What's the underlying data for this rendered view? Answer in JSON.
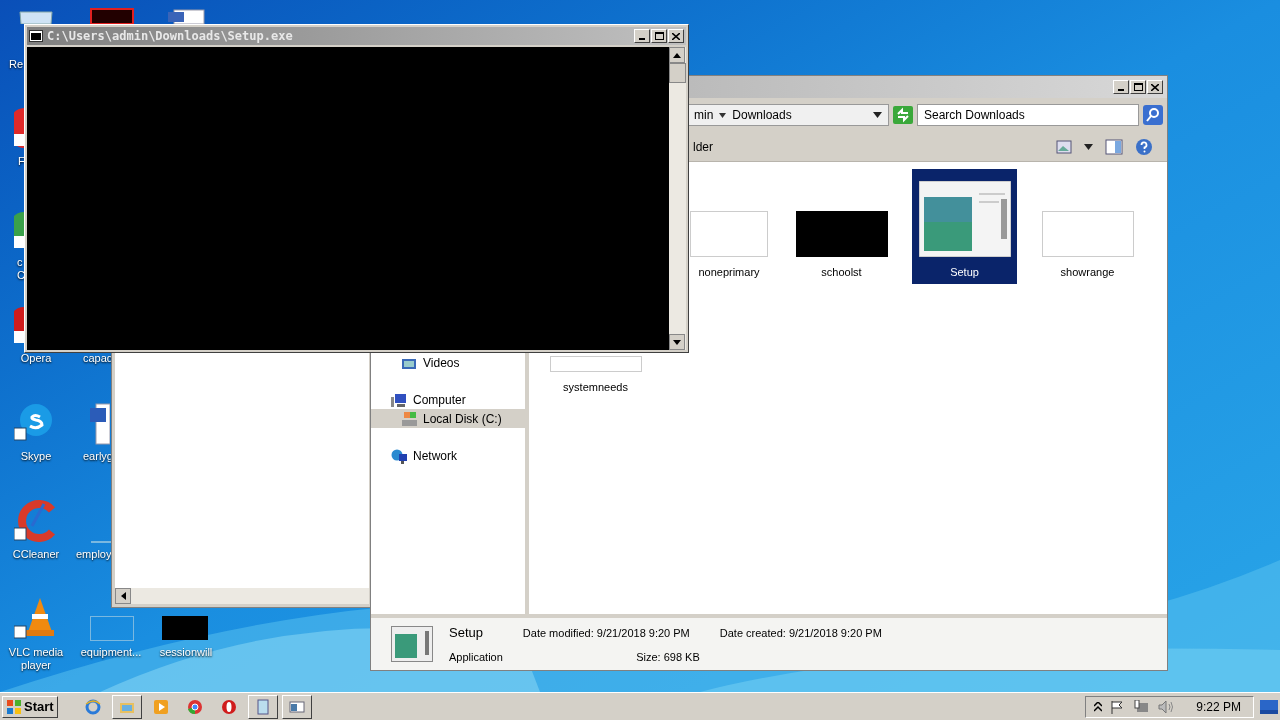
{
  "desktop_icons": [
    {
      "label": "Re",
      "kind": "bin"
    },
    {
      "label": "F",
      "kind": "redball"
    },
    {
      "label": "c\nC",
      "kind": "chrome"
    },
    {
      "label": "Opera",
      "kind": "opera"
    },
    {
      "label": "capad",
      "kind": "hidden"
    },
    {
      "label": "Skype",
      "kind": "skype"
    },
    {
      "label": "earlyg",
      "kind": "word"
    },
    {
      "label": "CCleaner",
      "kind": "ccleaner"
    },
    {
      "label": "employ",
      "kind": "line"
    },
    {
      "label": "VLC media\nplayer",
      "kind": "vlc"
    },
    {
      "label": "equipment...",
      "kind": "outline"
    },
    {
      "label": "sessionwill",
      "kind": "black"
    }
  ],
  "console": {
    "title": "C:\\Users\\admin\\Downloads\\Setup.exe"
  },
  "explorer": {
    "breadcrumb": [
      "min",
      "Downloads"
    ],
    "search": {
      "placeholder": "Search Downloads"
    },
    "toolbar_text": "lder",
    "nav": [
      {
        "label": "Videos",
        "kind": "videos",
        "selected": false
      },
      {
        "label": "Computer",
        "kind": "computer",
        "selected": false
      },
      {
        "label": "Local Disk (C:)",
        "kind": "disk",
        "selected": true
      },
      {
        "label": "Network",
        "kind": "network",
        "selected": false
      }
    ],
    "files": [
      {
        "name": "noneprimary",
        "kind": "blank",
        "selected": false
      },
      {
        "name": "schoolst",
        "kind": "dark",
        "selected": false
      },
      {
        "name": "Setup",
        "kind": "app",
        "selected": true
      },
      {
        "name": "showrange",
        "kind": "blank",
        "selected": false
      },
      {
        "name": "systemneeds",
        "kind": "blank",
        "selected": false
      }
    ],
    "details": {
      "name": "Setup",
      "type": "Application",
      "fields": [
        {
          "label": "Date modified:",
          "value": "9/21/2018 9:20 PM"
        },
        {
          "label": "Date created:",
          "value": "9/21/2018 9:20 PM"
        },
        {
          "label": "Size:",
          "value": "698 KB"
        }
      ]
    }
  },
  "taskbar": {
    "start": "Start",
    "apps": [
      {
        "kind": "ie",
        "pressed": false
      },
      {
        "kind": "folder",
        "pressed": true
      },
      {
        "kind": "media",
        "pressed": false
      },
      {
        "kind": "chrome",
        "pressed": false
      },
      {
        "kind": "opera",
        "pressed": false
      },
      {
        "kind": "notepad",
        "pressed": true
      },
      {
        "kind": "window",
        "pressed": true
      }
    ],
    "clock": "9:22 PM"
  }
}
